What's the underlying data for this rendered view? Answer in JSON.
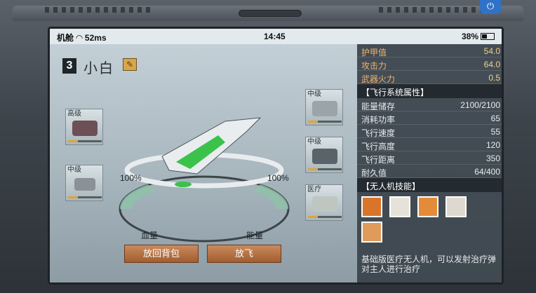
{
  "status": {
    "carrier": "机舱",
    "signal": "52ms",
    "time": "14:45",
    "battery": "38%"
  },
  "drone": {
    "slot_number": "3",
    "name": "小白"
  },
  "equipment_slots": [
    {
      "level": "高级",
      "progress": 0.3
    },
    {
      "level": "中级",
      "progress": 0.3
    },
    {
      "level": "中级",
      "progress": 0.3
    },
    {
      "level": "中级",
      "progress": 0.3
    },
    {
      "level": "医疗",
      "progress": 0.3
    }
  ],
  "gauges": {
    "health_pct": "100%",
    "energy_pct": "100%",
    "health_label": "血量",
    "energy_label": "能量"
  },
  "buttons": {
    "return_bag": "放回背包",
    "launch": "放飞"
  },
  "stats_top": [
    {
      "label": "护甲值",
      "value": "54.0"
    },
    {
      "label": "攻击力",
      "value": "64.0"
    },
    {
      "label": "武器火力",
      "value": "0.5"
    }
  ],
  "flight_section_title": "【飞行系统属性】",
  "flight_stats": [
    {
      "label": "能量储存",
      "value": "2100/2100"
    },
    {
      "label": "消耗功率",
      "value": "65"
    },
    {
      "label": "飞行速度",
      "value": "55"
    },
    {
      "label": "飞行高度",
      "value": "120"
    },
    {
      "label": "飞行距离",
      "value": "350"
    },
    {
      "label": "耐久值",
      "value": "64/400"
    }
  ],
  "skills_section_title": "【无人机技能】",
  "skills": [
    "skill-1-icon",
    "skill-2-icon",
    "skill-3-icon",
    "skill-4-icon",
    "skill-5-icon"
  ],
  "description": "基础版医疗无人机，可以发射治疗弹对主人进行治疗"
}
